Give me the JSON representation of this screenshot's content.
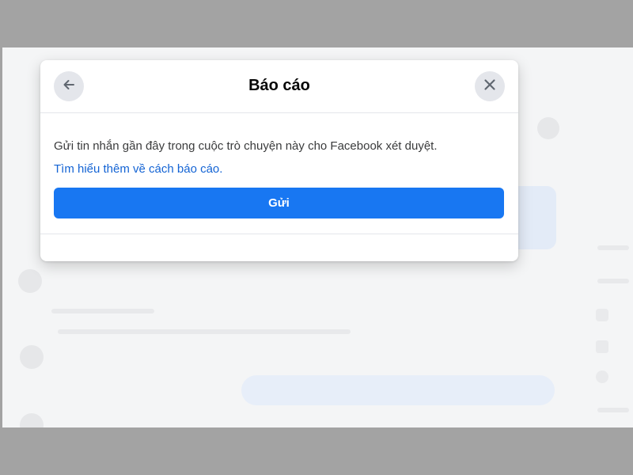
{
  "dialog": {
    "title": "Báo cáo",
    "description": "Gửi tin nhắn gần đây trong cuộc trò chuyện này cho Facebook xét duyệt.",
    "learn_more": "Tìm hiểu thêm về cách báo cáo.",
    "send_label": "Gửi",
    "back_icon": "arrow-left-icon",
    "close_icon": "close-icon"
  },
  "colors": {
    "primary": "#1877f2",
    "link": "#1464d4",
    "icon_button_bg": "#e4e6eb",
    "outer_background": "#a3a3a3"
  }
}
